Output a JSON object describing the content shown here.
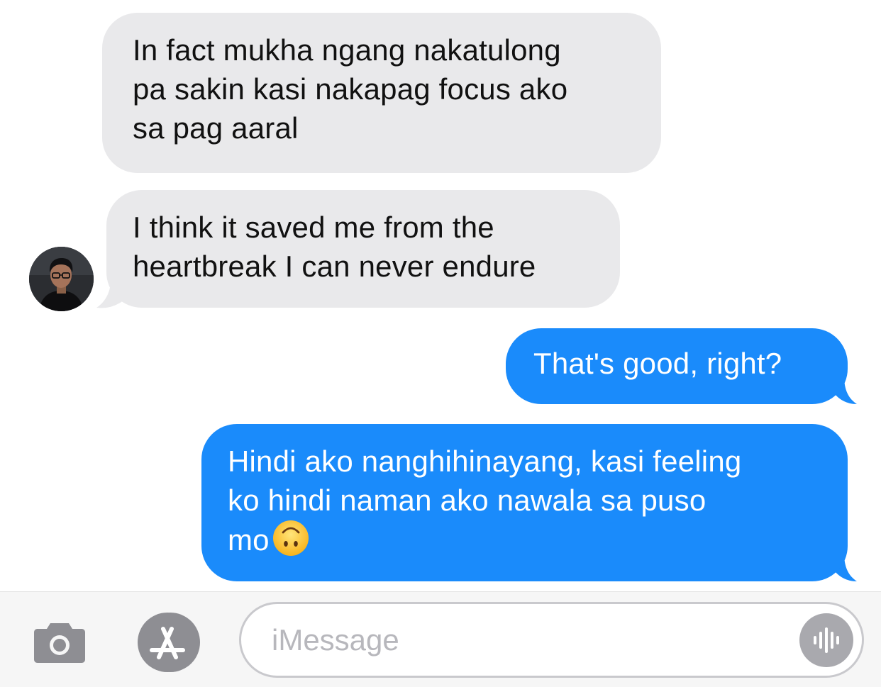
{
  "conversation": {
    "messages": [
      {
        "direction": "incoming",
        "text": "In fact mukha ngang nakatulong\npa sakin kasi nakapag focus ako\nsa pag aaral"
      },
      {
        "direction": "incoming",
        "text": "I think it saved me from the\nheartbreak I can never endure"
      },
      {
        "direction": "outgoing",
        "text": "That's good, right?"
      },
      {
        "direction": "outgoing",
        "text": "Hindi ako nanghihinayang, kasi feeling\nko hindi naman ako nawala sa puso\nmo"
      }
    ],
    "emoji": "upside-down-face"
  },
  "input_bar": {
    "placeholder": "iMessage",
    "icons": {
      "camera": "camera-icon",
      "apps": "app-store-icon",
      "audio": "audio-waveform-icon"
    }
  },
  "colors": {
    "incoming_bubble": "#e9e9eb",
    "outgoing_bubble": "#1a8bfb",
    "input_border": "#c9c9cd",
    "icon_gray": "#8e8e93"
  }
}
